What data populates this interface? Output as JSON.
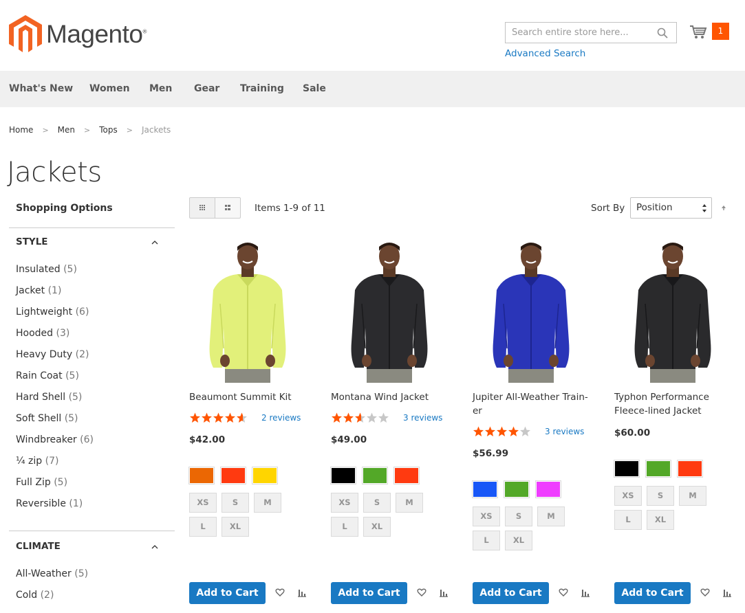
{
  "header": {
    "logo_text": "Magento",
    "logo_reg": "®",
    "search_placeholder": "Search entire store here...",
    "advanced_search": "Advanced Search",
    "cart_count": "1",
    "accent": "#ff5501",
    "link_color": "#1979c3"
  },
  "nav": [
    "What's New",
    "Women",
    "Men",
    "Gear",
    "Training",
    "Sale"
  ],
  "breadcrumbs": [
    "Home",
    "Men",
    "Tops",
    "Jackets"
  ],
  "breadcrumb_sep": ">",
  "page_title": "Jackets",
  "sidebar": {
    "title": "Shopping Options",
    "filters": [
      {
        "name": "STYLE",
        "items": [
          {
            "label": "Insulated",
            "count": "(5)"
          },
          {
            "label": "Jacket",
            "count": "(1)"
          },
          {
            "label": "Lightweight",
            "count": "(6)"
          },
          {
            "label": "Hooded",
            "count": "(3)"
          },
          {
            "label": "Heavy Duty",
            "count": "(2)"
          },
          {
            "label": "Rain Coat",
            "count": "(5)"
          },
          {
            "label": "Hard Shell",
            "count": "(5)"
          },
          {
            "label": "Soft Shell",
            "count": "(5)"
          },
          {
            "label": "Windbreaker",
            "count": "(6)"
          },
          {
            "label": "¼ zip",
            "count": "(7)"
          },
          {
            "label": "Full Zip",
            "count": "(5)"
          },
          {
            "label": "Reversible",
            "count": "(1)"
          }
        ]
      },
      {
        "name": "CLIMATE",
        "items": [
          {
            "label": "All-Weather",
            "count": "(5)"
          },
          {
            "label": "Cold",
            "count": "(2)"
          }
        ]
      }
    ]
  },
  "toolbar": {
    "items_count": "Items 1-9 of 11",
    "sort_label": "Sort By",
    "sort_value": "Position",
    "view_modes": [
      "grid-icon",
      "list-icon"
    ]
  },
  "products": [
    {
      "name_lines": [
        "Beaumont Summit Kit"
      ],
      "rating": 4.6,
      "reviews": "2 reviews",
      "price": "$42.00",
      "colors": [
        "#eb6703",
        "#ff3a10",
        "#ffd500"
      ],
      "sizes": [
        "XS",
        "S",
        "M",
        "L",
        "XL"
      ],
      "add_to_cart": "Add to Cart",
      "jacket_color": "#e2f07a",
      "jacket_shade": "#c9d95c"
    },
    {
      "name_lines": [
        "Montana Wind Jacket"
      ],
      "rating": 2.6,
      "reviews": "3 reviews",
      "price": "$49.00",
      "colors": [
        "#000000",
        "#53a828",
        "#ff3a10"
      ],
      "sizes": [
        "XS",
        "S",
        "M",
        "L",
        "XL"
      ],
      "add_to_cart": "Add to Cart",
      "jacket_color": "#2b2b2e",
      "jacket_shade": "#1a1a1c"
    },
    {
      "name_lines": [
        "Jupiter All-Weather Train-",
        "er"
      ],
      "rating": 4,
      "reviews": "3 reviews",
      "price": "$56.99",
      "colors": [
        "#1857f7",
        "#53a828",
        "#ef3dff"
      ],
      "sizes": [
        "XS",
        "S",
        "M",
        "L",
        "XL"
      ],
      "add_to_cart": "Add to Cart",
      "jacket_color": "#2a35b8",
      "jacket_shade": "#1d2590"
    },
    {
      "name_lines": [
        "Typhon Performance",
        "Fleece-lined Jacket"
      ],
      "rating": 0,
      "reviews": "",
      "price": "$60.00",
      "colors": [
        "#000000",
        "#53a828",
        "#ff3a10"
      ],
      "sizes": [
        "XS",
        "S",
        "M",
        "L",
        "XL"
      ],
      "add_to_cart": "Add to Cart",
      "jacket_color": "#2a2a2c",
      "jacket_shade": "#18181a"
    }
  ],
  "icons": {
    "search": "search-icon",
    "cart": "cart-icon",
    "wishlist": "heart-icon",
    "compare": "compare-icon",
    "caret": "chevron-up-icon"
  }
}
